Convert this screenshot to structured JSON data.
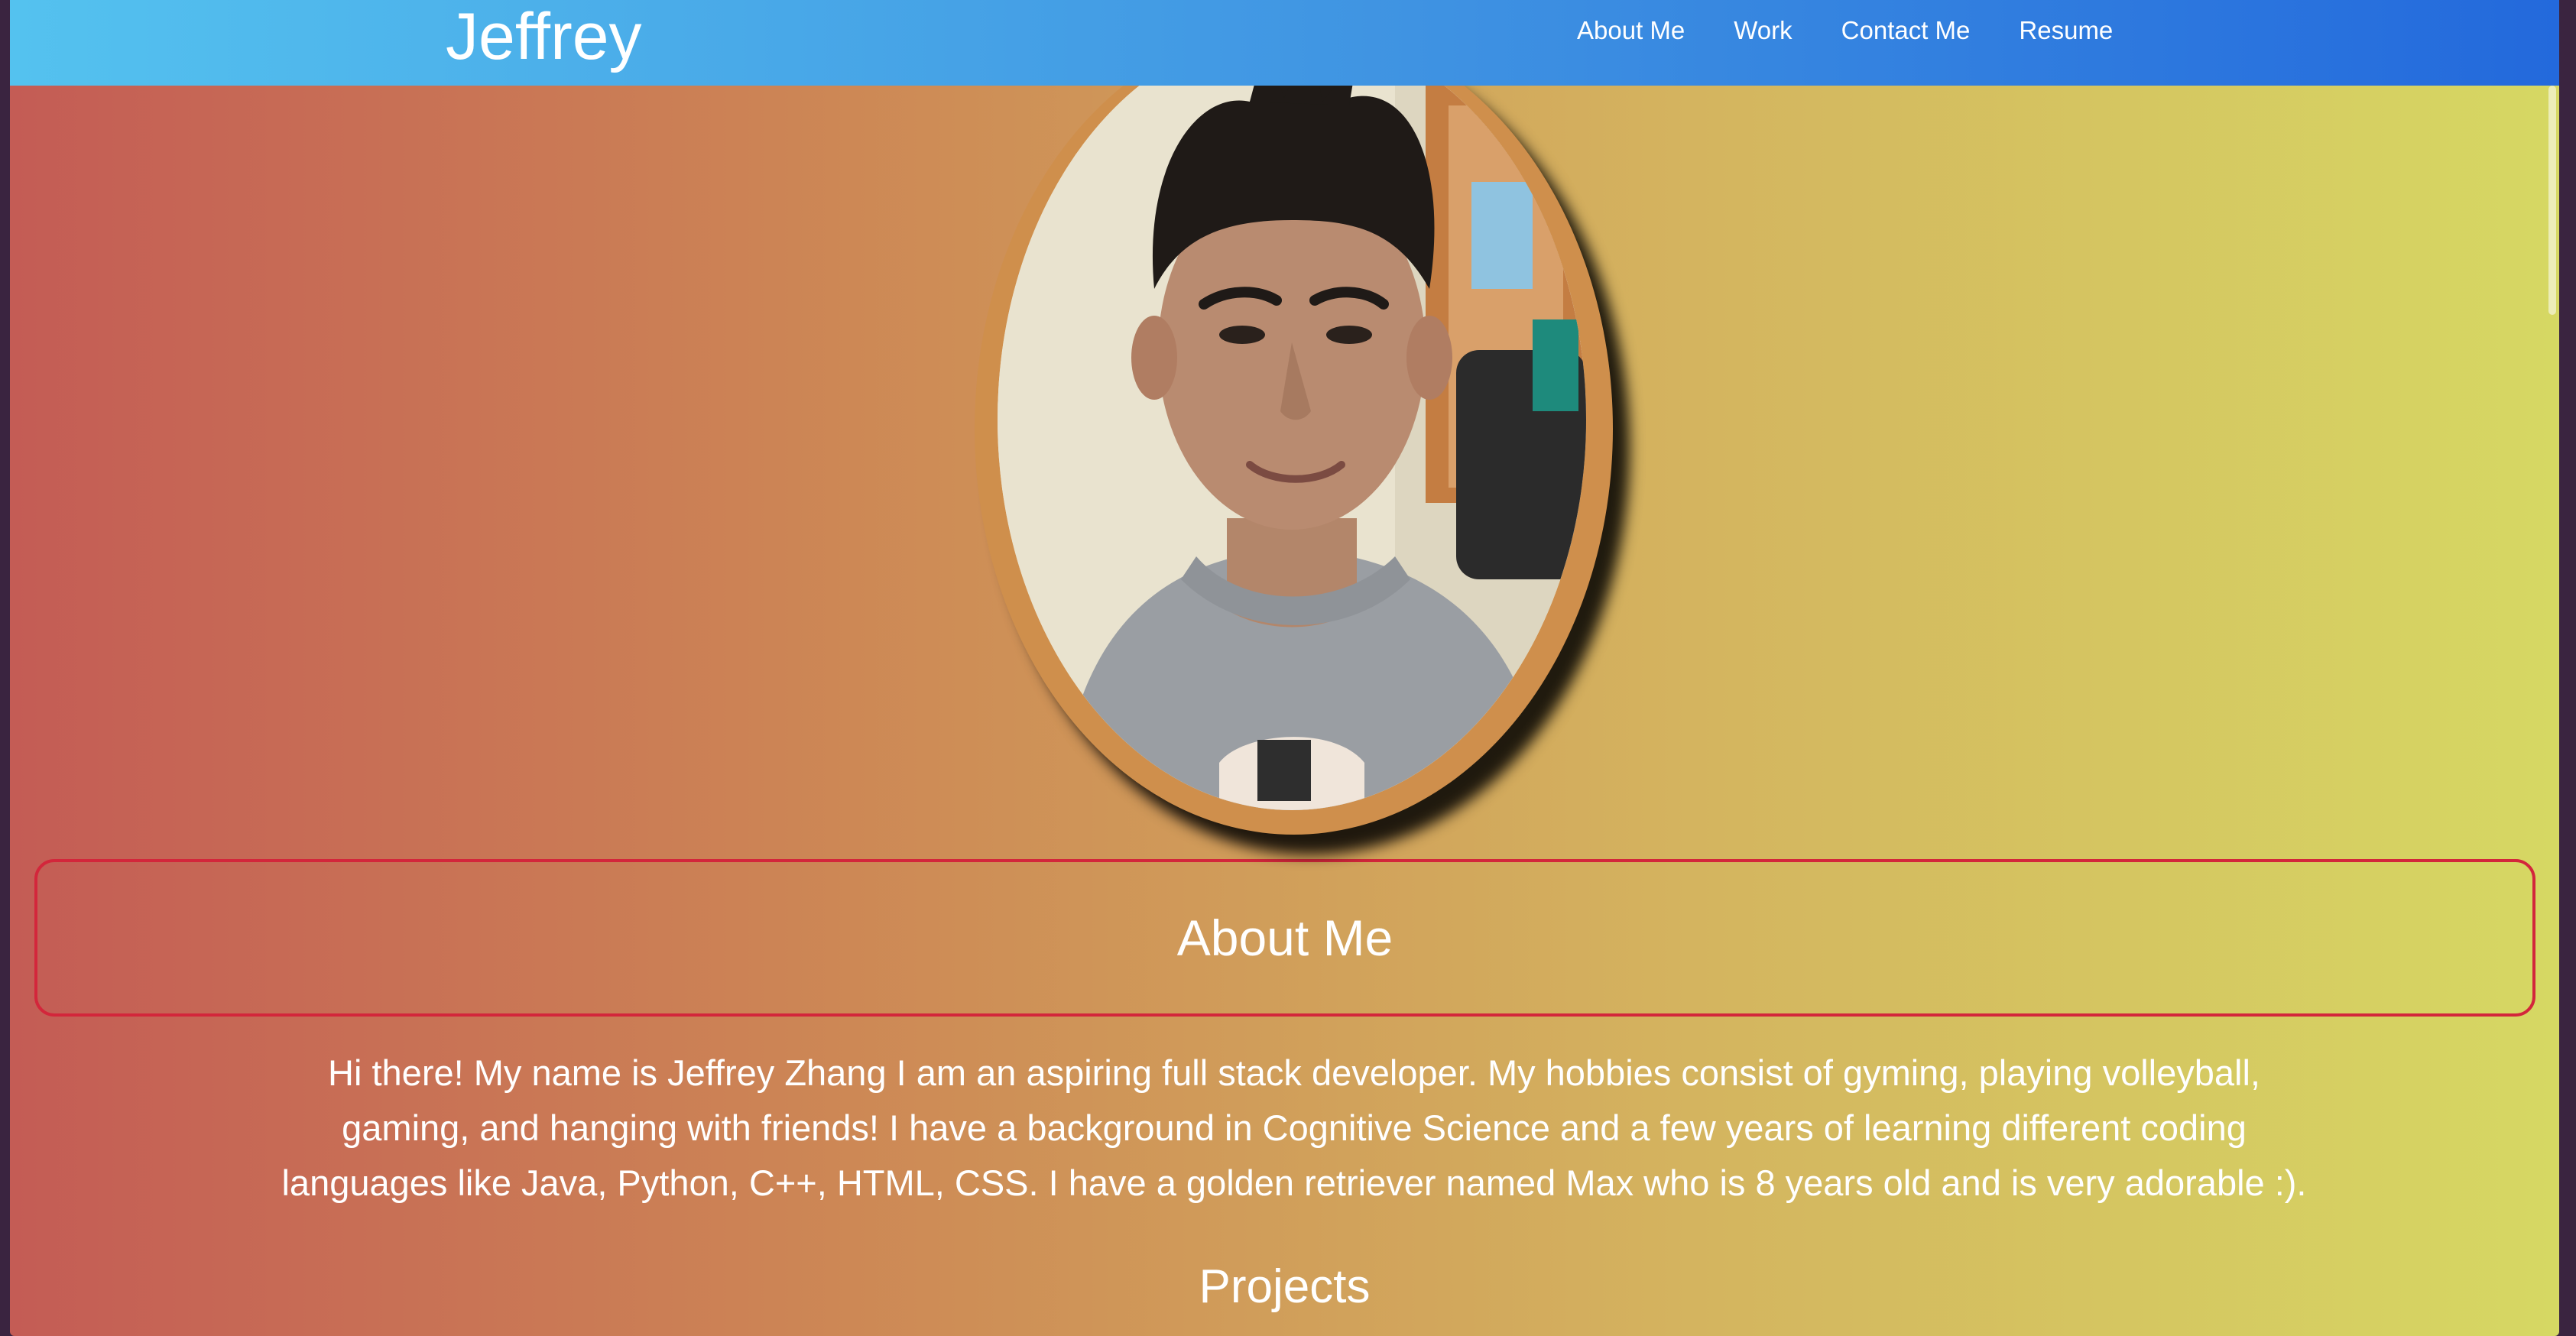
{
  "navbar": {
    "brand": "Jeffrey",
    "links": [
      "About Me",
      "Work",
      "Contact Me",
      "Resume"
    ]
  },
  "about": {
    "title": "About Me",
    "text": "Hi there! My name is Jeffrey Zhang I am an aspiring full stack developer. My hobbies consist of gyming, playing volleyball, gaming, and hanging with friends! I have a background in Cognitive Science and a few years of learning different coding languages like Java, Python, C++, HTML, CSS. I have a golden retriever named Max who is 8 years old and is very adorable :)."
  },
  "projects": {
    "title": "Projects"
  },
  "colors": {
    "navbar_start": "#54c2ef",
    "navbar_end": "#2369dc",
    "background_start": "#c45c55",
    "background_end": "#d6d863",
    "about_border": "#d3263b",
    "portrait_frame": "#cf8f4c"
  }
}
